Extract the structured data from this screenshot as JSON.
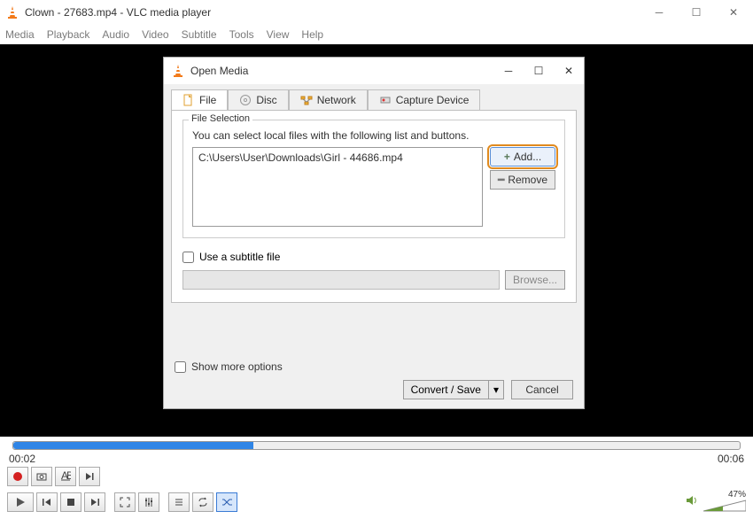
{
  "window": {
    "title": "Clown - 27683.mp4 - VLC media player"
  },
  "menu": {
    "media": "Media",
    "playback": "Playback",
    "audio": "Audio",
    "video": "Video",
    "subtitle": "Subtitle",
    "tools": "Tools",
    "view": "View",
    "help": "Help"
  },
  "dialog": {
    "title": "Open Media",
    "tabs": {
      "file": "File",
      "disc": "Disc",
      "network": "Network",
      "capture": "Capture Device"
    },
    "file_selection": {
      "legend": "File Selection",
      "desc": "You can select local files with the following list and buttons.",
      "files": [
        "C:\\Users\\User\\Downloads\\Girl - 44686.mp4"
      ],
      "add": "Add...",
      "remove": "Remove"
    },
    "subtitle": {
      "use_label": "Use a subtitle file",
      "browse": "Browse..."
    },
    "show_more": "Show more options",
    "convert_save": "Convert / Save",
    "cancel": "Cancel"
  },
  "player": {
    "time_current": "00:02",
    "time_total": "00:06",
    "volume_pct": "47%"
  }
}
